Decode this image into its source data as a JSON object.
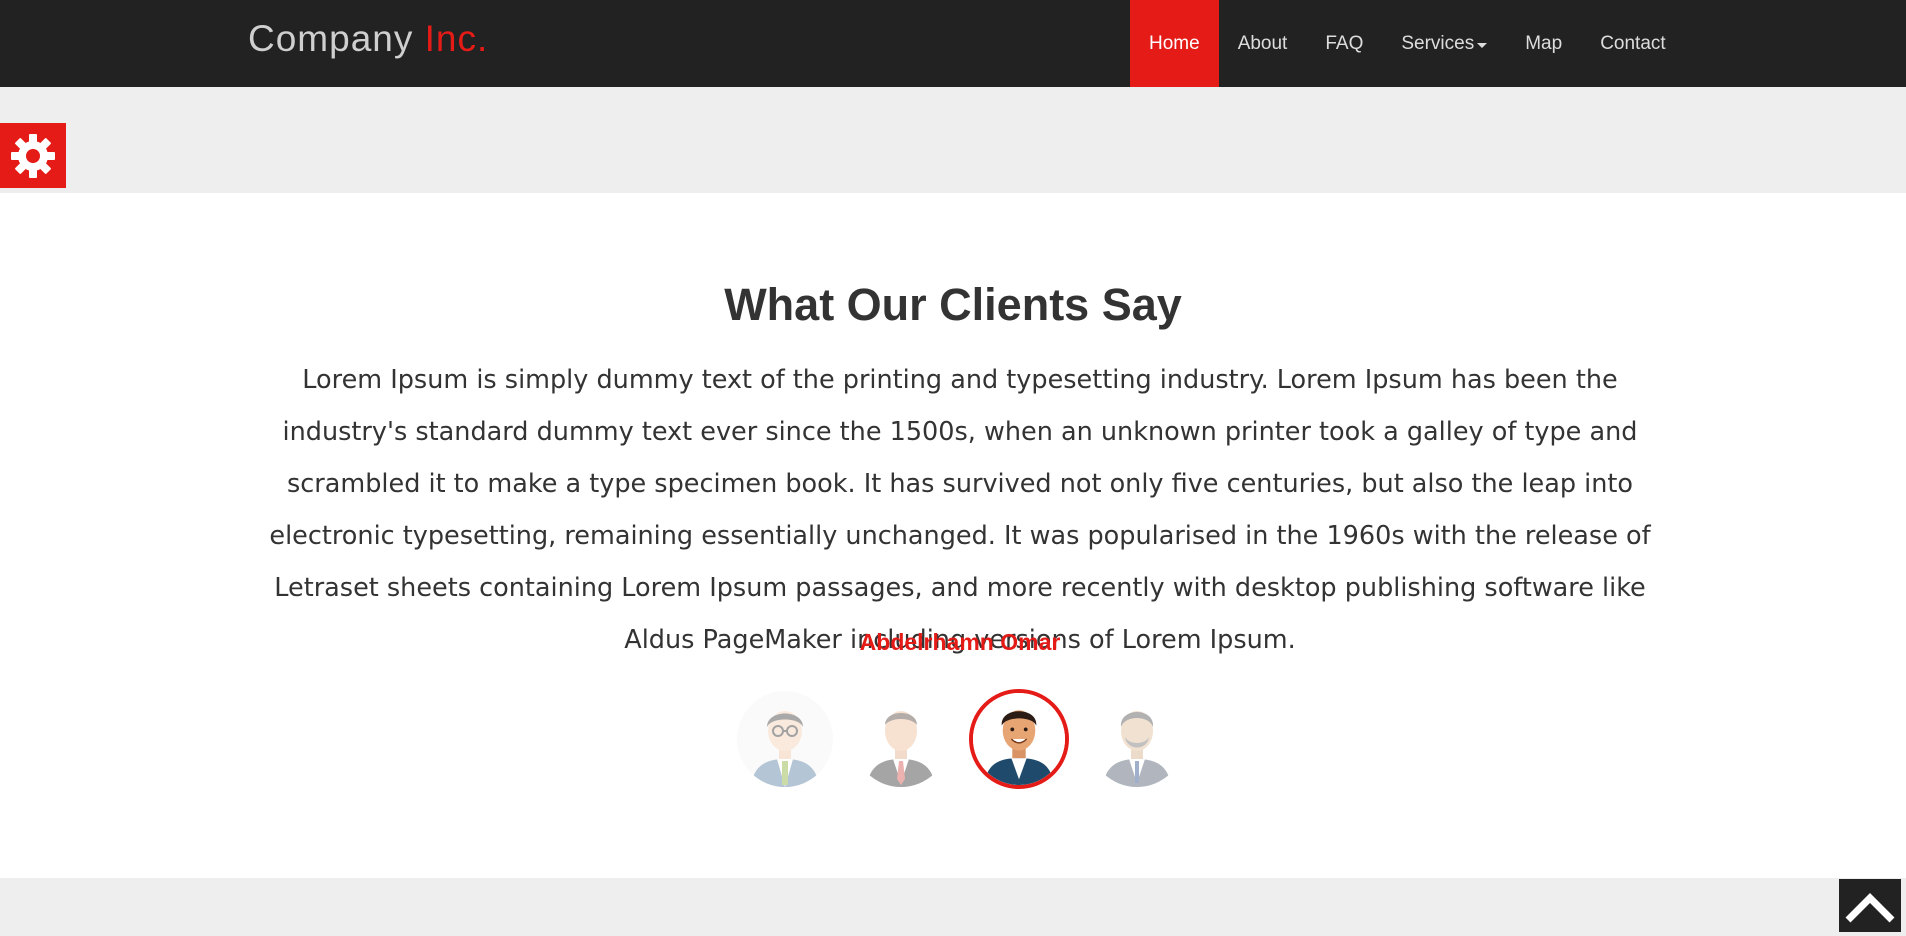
{
  "brand": {
    "name": "Company",
    "accent": "Inc."
  },
  "nav": {
    "items": [
      {
        "label": "Home",
        "active": true
      },
      {
        "label": "About"
      },
      {
        "label": "FAQ"
      },
      {
        "label": "Services",
        "dropdown": true
      },
      {
        "label": "Map"
      },
      {
        "label": "Contact"
      }
    ]
  },
  "testimonial": {
    "heading": "What Our Clients Say",
    "quote": "Lorem Ipsum is simply dummy text of the printing and typesetting industry. Lorem Ipsum has been the industry's standard dummy text ever since the 1500s, when an unknown printer took a galley of type and scrambled it to make a type specimen book. It has survived not only five centuries, but also the leap into electronic typesetting, remaining essentially unchanged. It was popularised in the 1960s with the release of Letraset sheets containing Lorem Ipsum passages, and more recently with desktop publishing software like Aldus PageMaker including versions of Lorem Ipsum.",
    "client_name": "Abdelrhamn Omar"
  },
  "icons": {
    "settings": "gear-icon",
    "scroll_top": "chevron-up-icon"
  },
  "colors": {
    "accent": "#e41b17",
    "navbar": "#222222",
    "band": "#eeeeee",
    "text": "#333333"
  }
}
